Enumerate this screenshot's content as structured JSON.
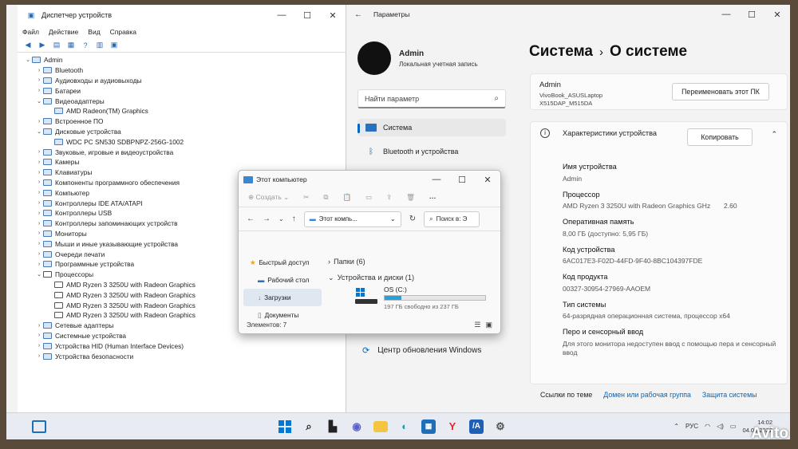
{
  "devmgr": {
    "title": "Диспетчер устройств",
    "menu": [
      "Файл",
      "Действие",
      "Вид",
      "Справка"
    ],
    "tree": [
      {
        "label": "Admin",
        "level": 0,
        "arrow": "⌄",
        "icon": "computer-icon"
      },
      {
        "label": "Bluetooth",
        "level": 1,
        "arrow": "›",
        "icon": "bluetooth-icon"
      },
      {
        "label": "Аудиовходы и аудиовыходы",
        "level": 1,
        "arrow": "›",
        "icon": "audio-icon"
      },
      {
        "label": "Батареи",
        "level": 1,
        "arrow": "›",
        "icon": "battery-icon"
      },
      {
        "label": "Видеоадаптеры",
        "level": 1,
        "arrow": "⌄",
        "icon": "display-adapter-icon"
      },
      {
        "label": "AMD Radeon(TM) Graphics",
        "level": 2,
        "arrow": "",
        "icon": "display-adapter-icon"
      },
      {
        "label": "Встроенное ПО",
        "level": 1,
        "arrow": "›",
        "icon": "firmware-icon"
      },
      {
        "label": "Дисковые устройства",
        "level": 1,
        "arrow": "⌄",
        "icon": "disk-icon"
      },
      {
        "label": "WDC PC SN530 SDBPNPZ-256G-1002",
        "level": 2,
        "arrow": "",
        "icon": "disk-icon"
      },
      {
        "label": "Звуковые, игровые и видеоустройства",
        "level": 1,
        "arrow": "›",
        "icon": "sound-icon"
      },
      {
        "label": "Камеры",
        "level": 1,
        "arrow": "›",
        "icon": "camera-icon"
      },
      {
        "label": "Клавиатуры",
        "level": 1,
        "arrow": "›",
        "icon": "keyboard-icon"
      },
      {
        "label": "Компоненты программного обеспечения",
        "level": 1,
        "arrow": "›",
        "icon": "software-icon"
      },
      {
        "label": "Компьютер",
        "level": 1,
        "arrow": "›",
        "icon": "computer-icon"
      },
      {
        "label": "Контроллеры IDE ATA/ATAPI",
        "level": 1,
        "arrow": "›",
        "icon": "controller-icon"
      },
      {
        "label": "Контроллеры USB",
        "level": 1,
        "arrow": "›",
        "icon": "usb-icon"
      },
      {
        "label": "Контроллеры запоминающих устройств",
        "level": 1,
        "arrow": "›",
        "icon": "storage-icon"
      },
      {
        "label": "Мониторы",
        "level": 1,
        "arrow": "›",
        "icon": "monitor-icon"
      },
      {
        "label": "Мыши и иные указывающие устройства",
        "level": 1,
        "arrow": "›",
        "icon": "mouse-icon"
      },
      {
        "label": "Очереди печати",
        "level": 1,
        "arrow": "›",
        "icon": "printer-icon"
      },
      {
        "label": "Программные устройства",
        "level": 1,
        "arrow": "›",
        "icon": "software-device-icon"
      },
      {
        "label": "Процессоры",
        "level": 1,
        "arrow": "⌄",
        "icon": "cpu-icon"
      },
      {
        "label": "AMD Ryzen 3 3250U with Radeon Graphics",
        "level": 2,
        "arrow": "",
        "icon": "cpu-icon"
      },
      {
        "label": "AMD Ryzen 3 3250U with Radeon Graphics",
        "level": 2,
        "arrow": "",
        "icon": "cpu-icon"
      },
      {
        "label": "AMD Ryzen 3 3250U with Radeon Graphics",
        "level": 2,
        "arrow": "",
        "icon": "cpu-icon"
      },
      {
        "label": "AMD Ryzen 3 3250U with Radeon Graphics",
        "level": 2,
        "arrow": "",
        "icon": "cpu-icon"
      },
      {
        "label": "Сетевые адаптеры",
        "level": 1,
        "arrow": "›",
        "icon": "network-icon"
      },
      {
        "label": "Системные устройства",
        "level": 1,
        "arrow": "›",
        "icon": "system-icon"
      },
      {
        "label": "Устройства HID (Human Interface Devices)",
        "level": 1,
        "arrow": "›",
        "icon": "hid-icon"
      },
      {
        "label": "Устройства безопасности",
        "level": 1,
        "arrow": "›",
        "icon": "security-icon"
      }
    ]
  },
  "settings": {
    "title": "Параметры",
    "user": {
      "name": "Admin",
      "type": "Локальная учетная запись"
    },
    "search_placeholder": "Найти параметр",
    "nav": [
      {
        "label": "Система",
        "icon": "system-icon",
        "selected": true
      },
      {
        "label": "Bluetooth и устройства",
        "icon": "bluetooth-icon",
        "selected": false
      }
    ],
    "breadcrumb": {
      "parent": "Система",
      "current": "О системе"
    },
    "device": {
      "name": "Admin",
      "model": "VivoBook_ASUSLaptop X515DAP_M515DA",
      "rename_button": "Переименовать этот ПК"
    },
    "specs": {
      "header": "Характеристики устройства",
      "copy_button": "Копировать",
      "rows": [
        {
          "label": "Имя устройства",
          "value": "Admin",
          "extra": ""
        },
        {
          "label": "Процессор",
          "value": "AMD Ryzen 3 3250U with Radeon Graphics GHz",
          "extra": "2.60"
        },
        {
          "label": "Оперативная память",
          "value": "8,00 ГБ (доступно: 5,95 ГБ)",
          "extra": ""
        },
        {
          "label": "Код устройства",
          "value": "6AC017E3-F02D-44FD-9F40-8BC104397FDE",
          "extra": ""
        },
        {
          "label": "Код продукта",
          "value": "00327-30954-27969-AAOEM",
          "extra": ""
        },
        {
          "label": "Тип системы",
          "value": "64-разрядная операционная система, процессор x64",
          "extra": ""
        },
        {
          "label": "Перо и сенсорный ввод",
          "value": "Для этого монитора недоступен ввод с помощью пера и сенсорный ввод",
          "extra": ""
        }
      ]
    },
    "links": [
      "Ссылки по теме",
      "Домен или рабочая группа",
      "Защита системы"
    ],
    "update_link": "Центр обновления Windows"
  },
  "explorer": {
    "title": "Этот компьютер",
    "create_label": "Создать",
    "address": "Этот компь...",
    "search_placeholder": "Поиск в: Э",
    "nav": [
      "Быстрый доступ",
      "Рабочий стол",
      "Загрузки",
      "Документы"
    ],
    "folders_section": "Папки (6)",
    "drives_section": "Устройства и диски (1)",
    "drive": {
      "name": "OS (C:)",
      "free_text": "197 ГБ свободно из 237 ГБ",
      "used_fraction": 0.17
    },
    "status": "Элементов: 7"
  },
  "taskbar": {
    "lang": "РУС",
    "time": "14:02",
    "date": "04.06.2022",
    "apps": [
      "windows-start-icon",
      "search-icon",
      "widgets-icon",
      "chat-icon",
      "explorer-icon",
      "edge-icon",
      "store-icon",
      "yandex-icon",
      "app-icon",
      "settings-icon"
    ]
  },
  "watermark": "Avito"
}
